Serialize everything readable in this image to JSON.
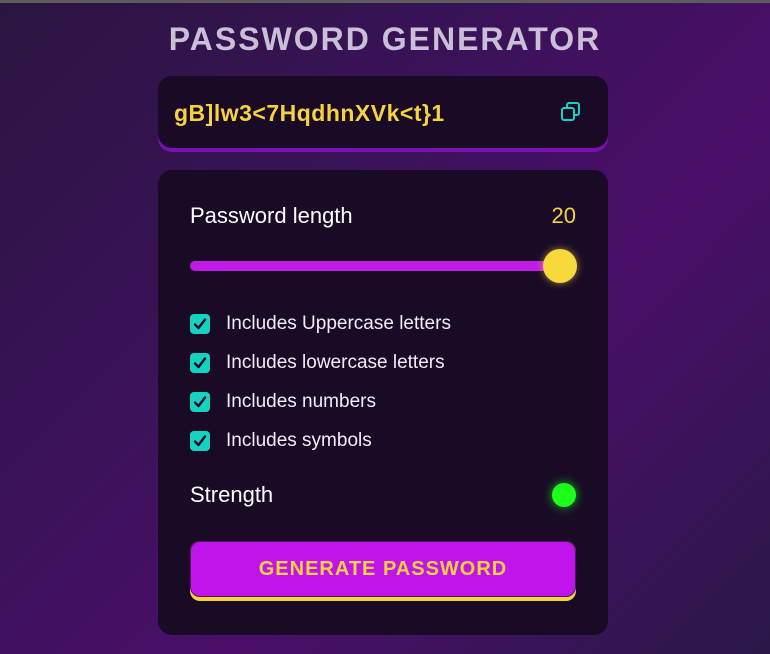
{
  "app": {
    "title": "PASSWORD GENERATOR"
  },
  "password": {
    "value": "gB]lw3<7HqdhnXVk<t}1",
    "copy_icon": "copy-icon"
  },
  "length": {
    "label": "Password length",
    "value": "20",
    "slider_fraction": 1.0
  },
  "options": [
    {
      "label": "Includes Uppercase letters",
      "checked": true
    },
    {
      "label": "Includes lowercase letters",
      "checked": true
    },
    {
      "label": "Includes numbers",
      "checked": true
    },
    {
      "label": "Includes symbols",
      "checked": true
    }
  ],
  "strength": {
    "label": "Strength",
    "indicator_color": "#1cff1c"
  },
  "generate": {
    "label": "GENERATE PASSWORD"
  },
  "colors": {
    "accent_yellow": "#f5d33e",
    "accent_purple": "#c11ae6",
    "checkbox_teal": "#14d3c0",
    "card_bg": "#190a26"
  }
}
